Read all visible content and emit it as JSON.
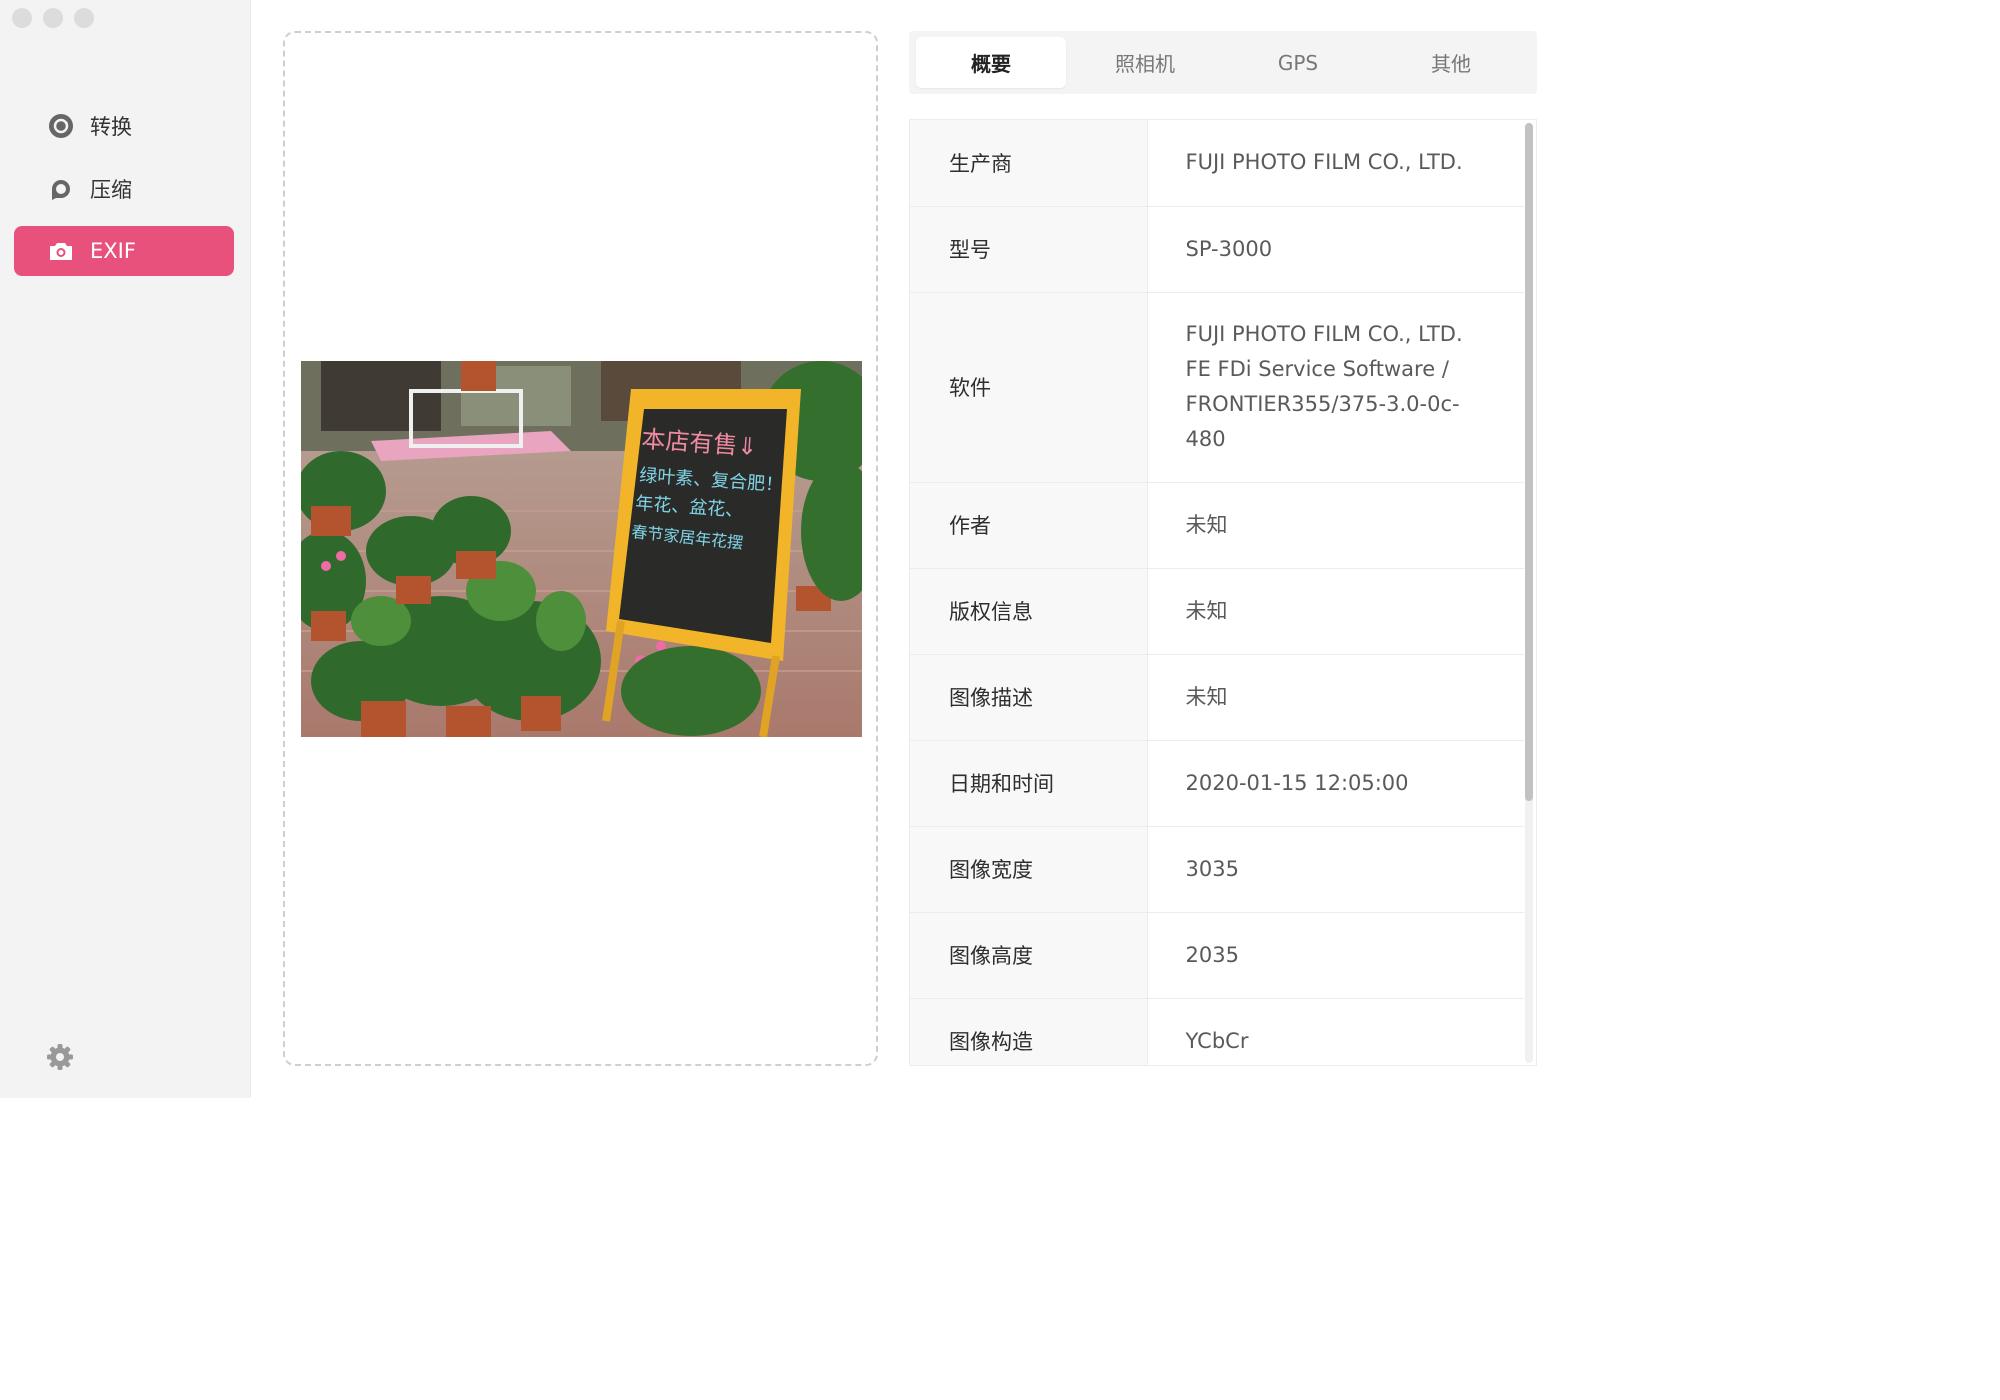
{
  "sidebar": {
    "items": [
      {
        "label": "转换",
        "icon": "convert-icon",
        "active": false
      },
      {
        "label": "压缩",
        "icon": "compress-icon",
        "active": false
      },
      {
        "label": "EXIF",
        "icon": "camera-icon",
        "active": true
      }
    ],
    "settings_icon": "gear-icon",
    "accent": "#e8517b"
  },
  "photo": {
    "sign_lines": [
      "本店有售⇓",
      "绿叶素、复合肥！",
      "年花、盆花、",
      "春节家居年花摆"
    ]
  },
  "tabs": [
    {
      "label": "概要",
      "active": true
    },
    {
      "label": "照相机",
      "active": false
    },
    {
      "label": "GPS",
      "active": false
    },
    {
      "label": "其他",
      "active": false
    }
  ],
  "exif": {
    "rows": [
      {
        "key": "生产商",
        "value": "FUJI PHOTO FILM CO., LTD."
      },
      {
        "key": "型号",
        "value": "SP-3000"
      },
      {
        "key": "软件",
        "value_lines": [
          "FUJI PHOTO FILM CO., LTD.",
          "FE FDi Service Software /",
          "FRONTIER355/375-3.0-0c-",
          "480"
        ]
      },
      {
        "key": "作者",
        "value": "未知"
      },
      {
        "key": "版权信息",
        "value": "未知"
      },
      {
        "key": "图像描述",
        "value": "未知"
      },
      {
        "key": "日期和时间",
        "value": "2020-01-15 12:05:00"
      },
      {
        "key": "图像宽度",
        "value": "3035"
      },
      {
        "key": "图像高度",
        "value": "2035"
      },
      {
        "key": "图像构造",
        "value": "YCbCr"
      }
    ]
  }
}
